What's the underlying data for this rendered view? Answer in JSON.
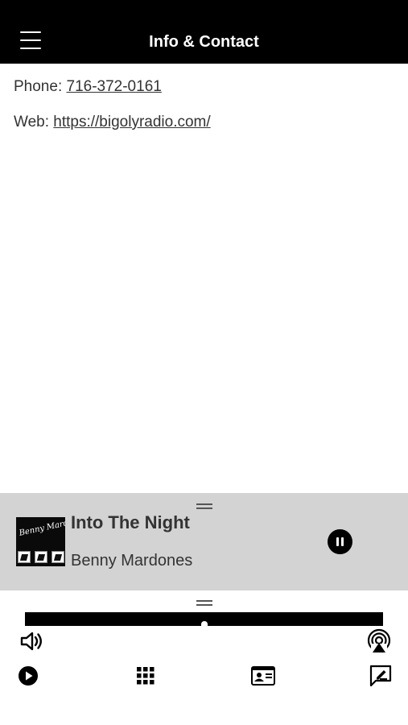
{
  "header": {
    "title": "Info & Contact",
    "menu_icon": "hamburger-menu-icon"
  },
  "contact": {
    "phone_label": "Phone: ",
    "phone_value": "716-372-0161",
    "web_label": "Web: ",
    "web_value": "https://bigolyradio.com/"
  },
  "now_playing": {
    "track_title": "Into The Night",
    "artist": "Benny Mardones",
    "album_art_text": "Benny Mardones",
    "state": "playing",
    "pause_icon": "pause-icon"
  },
  "controls": {
    "volume_icon": "volume-icon",
    "airplay_icon": "airplay-icon",
    "volume_level": 0.5
  },
  "tab_bar": {
    "items": [
      {
        "icon": "play-icon"
      },
      {
        "icon": "grid-icon"
      },
      {
        "icon": "contact-card-icon"
      },
      {
        "icon": "compose-message-icon"
      }
    ]
  },
  "colors": {
    "header_bg": "#000000",
    "player_bg": "#d3d3d3",
    "text": "#333333"
  }
}
